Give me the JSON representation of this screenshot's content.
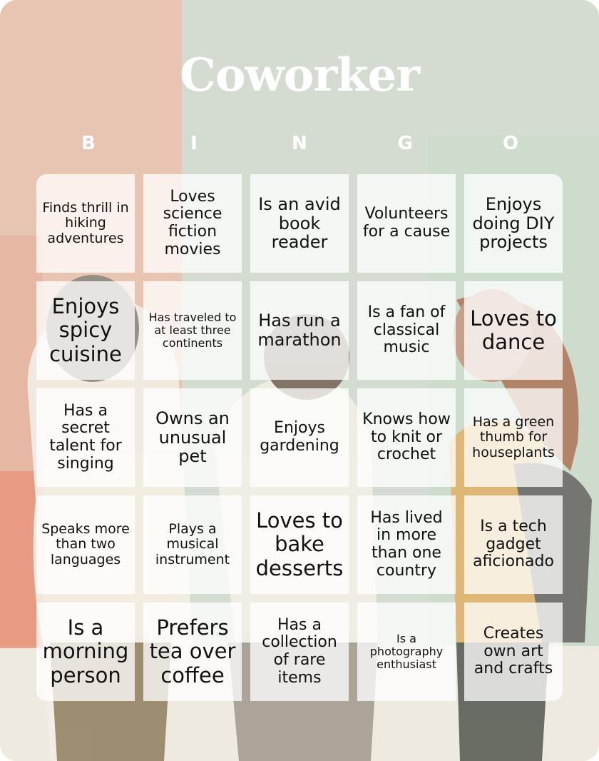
{
  "title": "Coworker",
  "header_letters": [
    "B",
    "I",
    "N",
    "G",
    "O"
  ],
  "colors": {
    "title_text": "#ffffff",
    "cell_text": "#111111",
    "bg_peach": "#e8c5b2",
    "bg_sage": "#d4dbd1",
    "bg_cream": "#eeeadf",
    "bg_coral": "#e89a82"
  },
  "background_image": "coworkers-illustration",
  "cells": [
    [
      "Finds thrill in hiking adventures",
      "Loves science fiction movies",
      "Is an avid book reader",
      "Volunteers for a cause",
      "Enjoys doing DIY projects"
    ],
    [
      "Enjoys spicy cuisine",
      "Has traveled to at least three continents",
      "Has run a marathon",
      "Is a fan of classical music",
      "Loves to dance"
    ],
    [
      "Has a secret talent for singing",
      "Owns an unusual pet",
      "Enjoys gardening",
      "Knows how to knit or crochet",
      "Has a green thumb for houseplants"
    ],
    [
      "Speaks more than two languages",
      "Plays a musical instrument",
      "Loves to bake desserts",
      "Has lived in more than one country",
      "Is a tech gadget aficionado"
    ],
    [
      "Is a morning person",
      "Prefers tea over coffee",
      "Has a collection of rare items",
      "Is a photography enthusiast",
      "Creates own art and crafts"
    ]
  ]
}
